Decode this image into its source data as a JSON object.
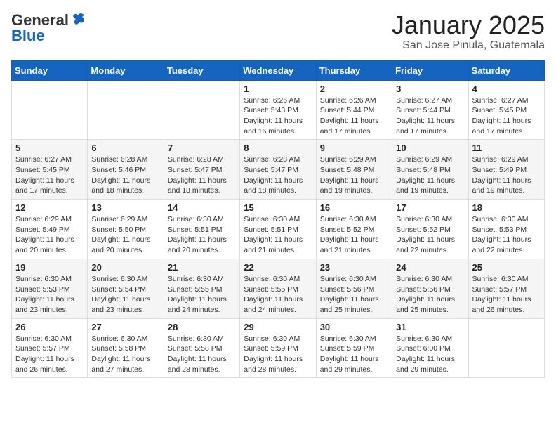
{
  "header": {
    "logo_general": "General",
    "logo_blue": "Blue",
    "month_title": "January 2025",
    "subtitle": "San Jose Pinula, Guatemala"
  },
  "days_of_week": [
    "Sunday",
    "Monday",
    "Tuesday",
    "Wednesday",
    "Thursday",
    "Friday",
    "Saturday"
  ],
  "weeks": [
    [
      {
        "day": "",
        "info": ""
      },
      {
        "day": "",
        "info": ""
      },
      {
        "day": "",
        "info": ""
      },
      {
        "day": "1",
        "info": "Sunrise: 6:26 AM\nSunset: 5:43 PM\nDaylight: 11 hours and 16 minutes."
      },
      {
        "day": "2",
        "info": "Sunrise: 6:26 AM\nSunset: 5:44 PM\nDaylight: 11 hours and 17 minutes."
      },
      {
        "day": "3",
        "info": "Sunrise: 6:27 AM\nSunset: 5:44 PM\nDaylight: 11 hours and 17 minutes."
      },
      {
        "day": "4",
        "info": "Sunrise: 6:27 AM\nSunset: 5:45 PM\nDaylight: 11 hours and 17 minutes."
      }
    ],
    [
      {
        "day": "5",
        "info": "Sunrise: 6:27 AM\nSunset: 5:45 PM\nDaylight: 11 hours and 17 minutes."
      },
      {
        "day": "6",
        "info": "Sunrise: 6:28 AM\nSunset: 5:46 PM\nDaylight: 11 hours and 18 minutes."
      },
      {
        "day": "7",
        "info": "Sunrise: 6:28 AM\nSunset: 5:47 PM\nDaylight: 11 hours and 18 minutes."
      },
      {
        "day": "8",
        "info": "Sunrise: 6:28 AM\nSunset: 5:47 PM\nDaylight: 11 hours and 18 minutes."
      },
      {
        "day": "9",
        "info": "Sunrise: 6:29 AM\nSunset: 5:48 PM\nDaylight: 11 hours and 19 minutes."
      },
      {
        "day": "10",
        "info": "Sunrise: 6:29 AM\nSunset: 5:48 PM\nDaylight: 11 hours and 19 minutes."
      },
      {
        "day": "11",
        "info": "Sunrise: 6:29 AM\nSunset: 5:49 PM\nDaylight: 11 hours and 19 minutes."
      }
    ],
    [
      {
        "day": "12",
        "info": "Sunrise: 6:29 AM\nSunset: 5:49 PM\nDaylight: 11 hours and 20 minutes."
      },
      {
        "day": "13",
        "info": "Sunrise: 6:29 AM\nSunset: 5:50 PM\nDaylight: 11 hours and 20 minutes."
      },
      {
        "day": "14",
        "info": "Sunrise: 6:30 AM\nSunset: 5:51 PM\nDaylight: 11 hours and 20 minutes."
      },
      {
        "day": "15",
        "info": "Sunrise: 6:30 AM\nSunset: 5:51 PM\nDaylight: 11 hours and 21 minutes."
      },
      {
        "day": "16",
        "info": "Sunrise: 6:30 AM\nSunset: 5:52 PM\nDaylight: 11 hours and 21 minutes."
      },
      {
        "day": "17",
        "info": "Sunrise: 6:30 AM\nSunset: 5:52 PM\nDaylight: 11 hours and 22 minutes."
      },
      {
        "day": "18",
        "info": "Sunrise: 6:30 AM\nSunset: 5:53 PM\nDaylight: 11 hours and 22 minutes."
      }
    ],
    [
      {
        "day": "19",
        "info": "Sunrise: 6:30 AM\nSunset: 5:53 PM\nDaylight: 11 hours and 23 minutes."
      },
      {
        "day": "20",
        "info": "Sunrise: 6:30 AM\nSunset: 5:54 PM\nDaylight: 11 hours and 23 minutes."
      },
      {
        "day": "21",
        "info": "Sunrise: 6:30 AM\nSunset: 5:55 PM\nDaylight: 11 hours and 24 minutes."
      },
      {
        "day": "22",
        "info": "Sunrise: 6:30 AM\nSunset: 5:55 PM\nDaylight: 11 hours and 24 minutes."
      },
      {
        "day": "23",
        "info": "Sunrise: 6:30 AM\nSunset: 5:56 PM\nDaylight: 11 hours and 25 minutes."
      },
      {
        "day": "24",
        "info": "Sunrise: 6:30 AM\nSunset: 5:56 PM\nDaylight: 11 hours and 25 minutes."
      },
      {
        "day": "25",
        "info": "Sunrise: 6:30 AM\nSunset: 5:57 PM\nDaylight: 11 hours and 26 minutes."
      }
    ],
    [
      {
        "day": "26",
        "info": "Sunrise: 6:30 AM\nSunset: 5:57 PM\nDaylight: 11 hours and 26 minutes."
      },
      {
        "day": "27",
        "info": "Sunrise: 6:30 AM\nSunset: 5:58 PM\nDaylight: 11 hours and 27 minutes."
      },
      {
        "day": "28",
        "info": "Sunrise: 6:30 AM\nSunset: 5:58 PM\nDaylight: 11 hours and 28 minutes."
      },
      {
        "day": "29",
        "info": "Sunrise: 6:30 AM\nSunset: 5:59 PM\nDaylight: 11 hours and 28 minutes."
      },
      {
        "day": "30",
        "info": "Sunrise: 6:30 AM\nSunset: 5:59 PM\nDaylight: 11 hours and 29 minutes."
      },
      {
        "day": "31",
        "info": "Sunrise: 6:30 AM\nSunset: 6:00 PM\nDaylight: 11 hours and 29 minutes."
      },
      {
        "day": "",
        "info": ""
      }
    ]
  ]
}
